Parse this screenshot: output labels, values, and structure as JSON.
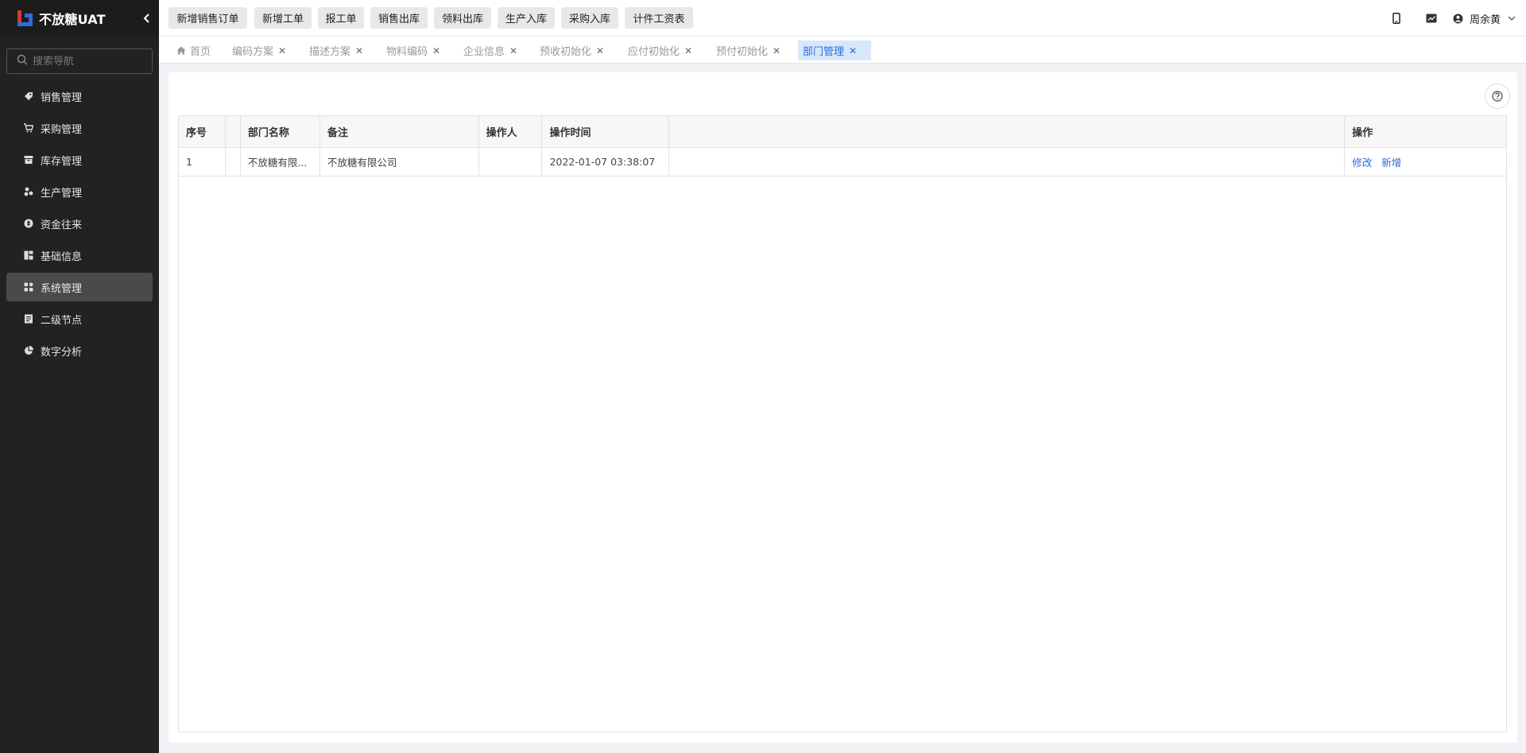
{
  "app": {
    "title": "不放糖UAT"
  },
  "sidebar": {
    "search_placeholder": "搜索导航",
    "items": [
      {
        "label": "销售管理",
        "icon": "tag-icon"
      },
      {
        "label": "采购管理",
        "icon": "cart-icon"
      },
      {
        "label": "库存管理",
        "icon": "archive-icon"
      },
      {
        "label": "生产管理",
        "icon": "factory-icon"
      },
      {
        "label": "资金往来",
        "icon": "money-icon"
      },
      {
        "label": "基础信息",
        "icon": "dashboard-icon"
      },
      {
        "label": "系统管理",
        "icon": "apps-icon",
        "active": true
      },
      {
        "label": "二级节点",
        "icon": "document-icon"
      },
      {
        "label": "数字分析",
        "icon": "pie-chart-icon"
      }
    ]
  },
  "toolbar": {
    "quick_actions": [
      "新增销售订单",
      "新增工单",
      "报工单",
      "销售出库",
      "领料出库",
      "生产入库",
      "采购入库",
      "计件工资表"
    ],
    "user_name": "周余黄"
  },
  "tabs": [
    {
      "label": "首页",
      "closable": false,
      "home": true
    },
    {
      "label": "编码方案",
      "closable": true
    },
    {
      "label": "描述方案",
      "closable": true
    },
    {
      "label": "物料编码",
      "closable": true
    },
    {
      "label": "企业信息",
      "closable": true
    },
    {
      "label": "预收初始化",
      "closable": true
    },
    {
      "label": "应付初始化",
      "closable": true
    },
    {
      "label": "预付初始化",
      "closable": true
    },
    {
      "label": "部门管理",
      "closable": true,
      "active": true
    }
  ],
  "table": {
    "columns": [
      "序号",
      "",
      "部门名称",
      "备注",
      "操作人",
      "操作时间",
      "",
      "操作"
    ],
    "rows": [
      {
        "index": "1",
        "blank": "",
        "dept_name": "不放糖有限...",
        "remark": "不放糖有限公司",
        "operator": "",
        "time": "2022-01-07 03:38:07",
        "spacer": "",
        "actions": [
          "修改",
          "新增"
        ]
      }
    ]
  },
  "colors": {
    "accent": "#2d6bd6",
    "sidebar_bg": "#222222",
    "active_tab_bg": "#d9e7fa"
  }
}
